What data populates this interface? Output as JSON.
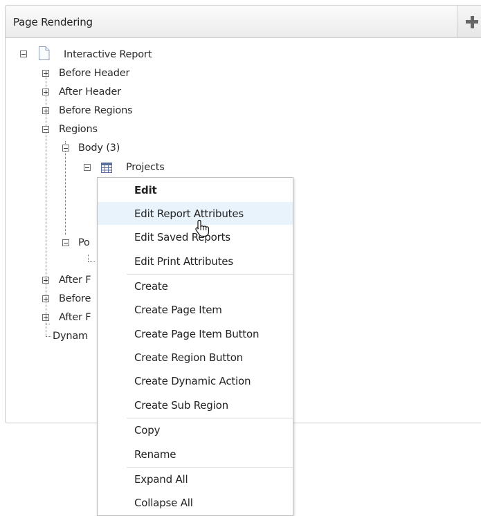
{
  "panel": {
    "title": "Page Rendering",
    "add_icon": "plus-icon"
  },
  "tree": {
    "root": {
      "label": "Interactive Report",
      "icon": "page-icon",
      "state": "expanded"
    },
    "nodes": [
      {
        "label": "Before Header",
        "state": "collapsed"
      },
      {
        "label": "After Header",
        "state": "collapsed"
      },
      {
        "label": "Before Regions",
        "state": "collapsed"
      },
      {
        "label": "Regions",
        "state": "expanded"
      },
      {
        "label": "Body (3)",
        "state": "expanded"
      },
      {
        "label": "Projects",
        "icon": "report-grid-icon",
        "state": "expanded"
      },
      {
        "label": "Po",
        "state": "expanded"
      },
      {
        "label": "After F",
        "state": "collapsed"
      },
      {
        "label": "Before",
        "state": "collapsed"
      },
      {
        "label": "After F",
        "state": "collapsed"
      },
      {
        "label": "Dynam",
        "state": "leaf"
      }
    ]
  },
  "context_menu": {
    "items": [
      {
        "label": "Edit",
        "bold": true
      },
      {
        "label": "Edit Report Attributes",
        "hover": true
      },
      {
        "label": "Edit Saved Reports"
      },
      {
        "label": "Edit Print Attributes"
      },
      {
        "label": "Create"
      },
      {
        "label": "Create Page Item"
      },
      {
        "label": "Create Page Item Button"
      },
      {
        "label": "Create Region Button"
      },
      {
        "label": "Create Dynamic Action"
      },
      {
        "label": "Create Sub Region"
      },
      {
        "label": "Copy"
      },
      {
        "label": "Rename"
      },
      {
        "label": "Expand All"
      },
      {
        "label": "Collapse All"
      }
    ]
  },
  "colors": {
    "hover_background": "#e8f3fb",
    "report_icon": "#5b6f9c"
  },
  "cursor": "hand-pointer-cursor"
}
